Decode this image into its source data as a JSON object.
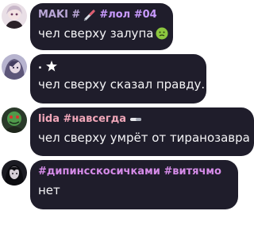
{
  "messages": [
    {
      "name_parts": [
        "MAKI #",
        "#лол #04"
      ],
      "name_colors": [
        "#b9a6d6",
        "#c99bff"
      ],
      "name_icon": "syringe-icon",
      "text": "чел сверху залупа",
      "text_icon": "nauseated-face-icon"
    },
    {
      "name_parts": [
        ".",
        ""
      ],
      "name_colors": [
        "#ffffff",
        "#ffffff"
      ],
      "name_icon": "star-icon",
      "text": "чел сверху сказал правду.",
      "text_icon": ""
    },
    {
      "name_parts": [
        "lida #навсегда",
        ""
      ],
      "name_colors": [
        "#f0a6b8",
        "#f0a6b8"
      ],
      "name_icon": "pill-icon",
      "text": "чел сверху умрёт от тиранозавра",
      "text_icon": ""
    },
    {
      "name_parts": [
        "#дипинсскосичками #витячмо",
        ""
      ],
      "name_colors": [
        "#d58be8",
        "#d58be8"
      ],
      "name_icon": "",
      "text": "нет",
      "text_icon": ""
    }
  ]
}
